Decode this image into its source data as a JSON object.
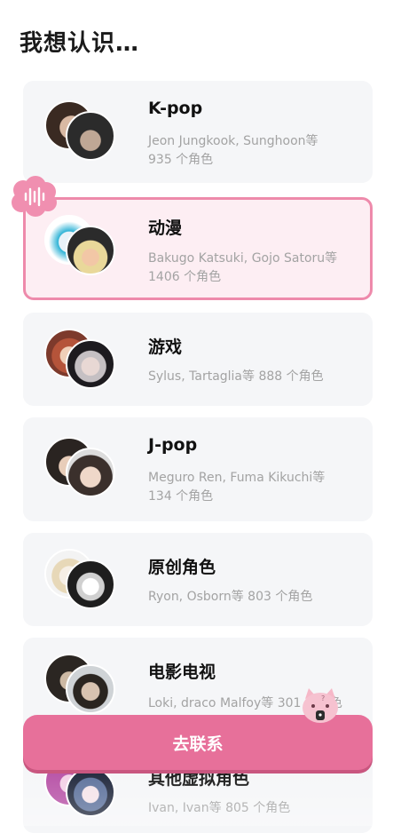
{
  "page": {
    "title": "我想认识…"
  },
  "categories": [
    {
      "title": "K-pop",
      "subtitle": "Jeon Jungkook, Sunghoon等 935 个角色"
    },
    {
      "title": "动漫",
      "subtitle": "Bakugo Katsuki, Gojo Satoru等 1406 个角色"
    },
    {
      "title": "游戏",
      "subtitle": "Sylus, Tartaglia等 888 个角色"
    },
    {
      "title": "J-pop",
      "subtitle": "Meguro Ren, Fuma Kikuchi等 134 个角色"
    },
    {
      "title": "原创角色",
      "subtitle": "Ryon, Osborn等 803 个角色"
    },
    {
      "title": "电影电视",
      "subtitle": "Loki, draco Malfoy等 301 个角色"
    },
    {
      "title": "其他虚拟角色",
      "subtitle": "Ivan, Ivan等 805 个角色"
    }
  ],
  "cta": {
    "label": "去联系"
  },
  "icons": {
    "voice": "voice-wave-icon",
    "mascot": "pink-cat-mascot-icon"
  },
  "colors": {
    "accent": "#e7709a",
    "selected_border": "#ee8aab",
    "selected_bg": "#fdeef3",
    "card_bg": "#f5f6f8"
  }
}
